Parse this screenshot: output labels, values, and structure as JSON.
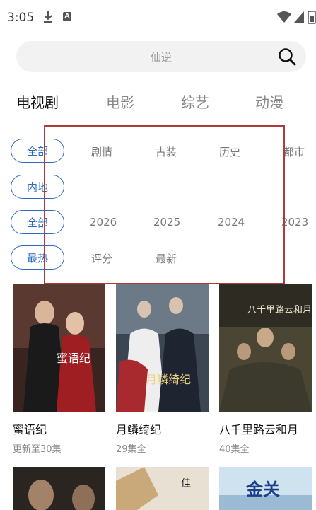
{
  "status_bar": {
    "time": "3:05",
    "a_badge": "A"
  },
  "search": {
    "placeholder": "仙逆"
  },
  "tabs": [
    "电视剧",
    "电影",
    "综艺",
    "动漫"
  ],
  "filters": {
    "genre": {
      "selected": "全部",
      "options": [
        "剧情",
        "古装",
        "历史",
        "都市"
      ]
    },
    "region": {
      "selected": "内地"
    },
    "year": {
      "selected": "全部",
      "options": [
        "2026",
        "2025",
        "2024",
        "2023"
      ]
    },
    "sort": {
      "selected": "最热",
      "options": [
        "评分",
        "最新"
      ]
    }
  },
  "cards": [
    {
      "title": "蜜语纪",
      "subtitle": "更新至30集"
    },
    {
      "title": "月鳞绮纪",
      "subtitle": "29集全"
    },
    {
      "title": "八千里路云和月",
      "subtitle": "40集全"
    }
  ],
  "poster_texts": {
    "p1": "蜜语纪",
    "p2": "月鳞绮纪",
    "p3": "八千里路云和月",
    "p6": "金关"
  },
  "colors": {
    "accent": "#2b6cc4",
    "highlight": "#b03a3a"
  }
}
